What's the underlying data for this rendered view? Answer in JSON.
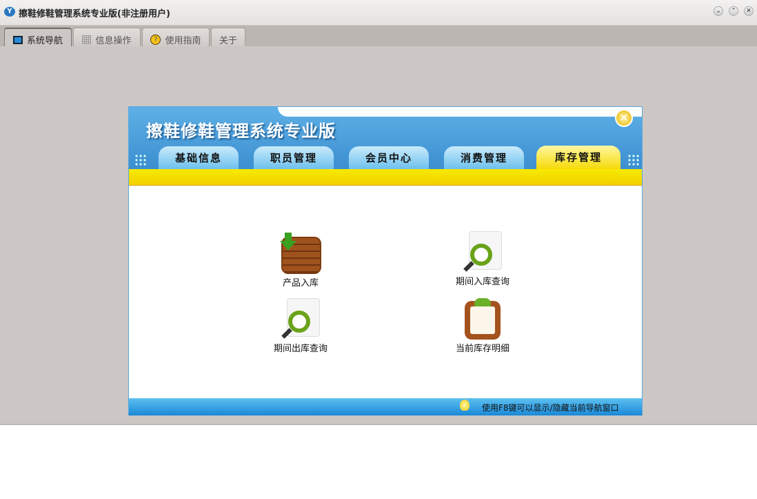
{
  "window": {
    "title": "擦鞋修鞋管理系统专业版(非注册用户)",
    "icon": "app-logo-icon",
    "controls": [
      "minimize",
      "maximize",
      "close"
    ]
  },
  "tabs": [
    {
      "label": "系统导航",
      "icon": "monitor-icon"
    },
    {
      "label": "信息操作",
      "icon": "grid-icon"
    },
    {
      "label": "使用指南",
      "icon": "help-icon"
    },
    {
      "label": "关于"
    }
  ],
  "panel": {
    "title": "擦鞋修鞋管理系统专业版",
    "nav": [
      "基础信息",
      "职员管理",
      "会员中心",
      "消费管理",
      "库存管理"
    ],
    "active_nav": "库存管理",
    "items": [
      {
        "label": "产品入库",
        "icon": "crate-download-icon"
      },
      {
        "label": "期间入库查询",
        "icon": "document-search-icon"
      },
      {
        "label": "期间出库查询",
        "icon": "document-search-icon"
      },
      {
        "label": "当前库存明细",
        "icon": "clipboard-icon"
      }
    ],
    "hint": "使用F8键可以显示/隐藏当前导航窗口"
  }
}
